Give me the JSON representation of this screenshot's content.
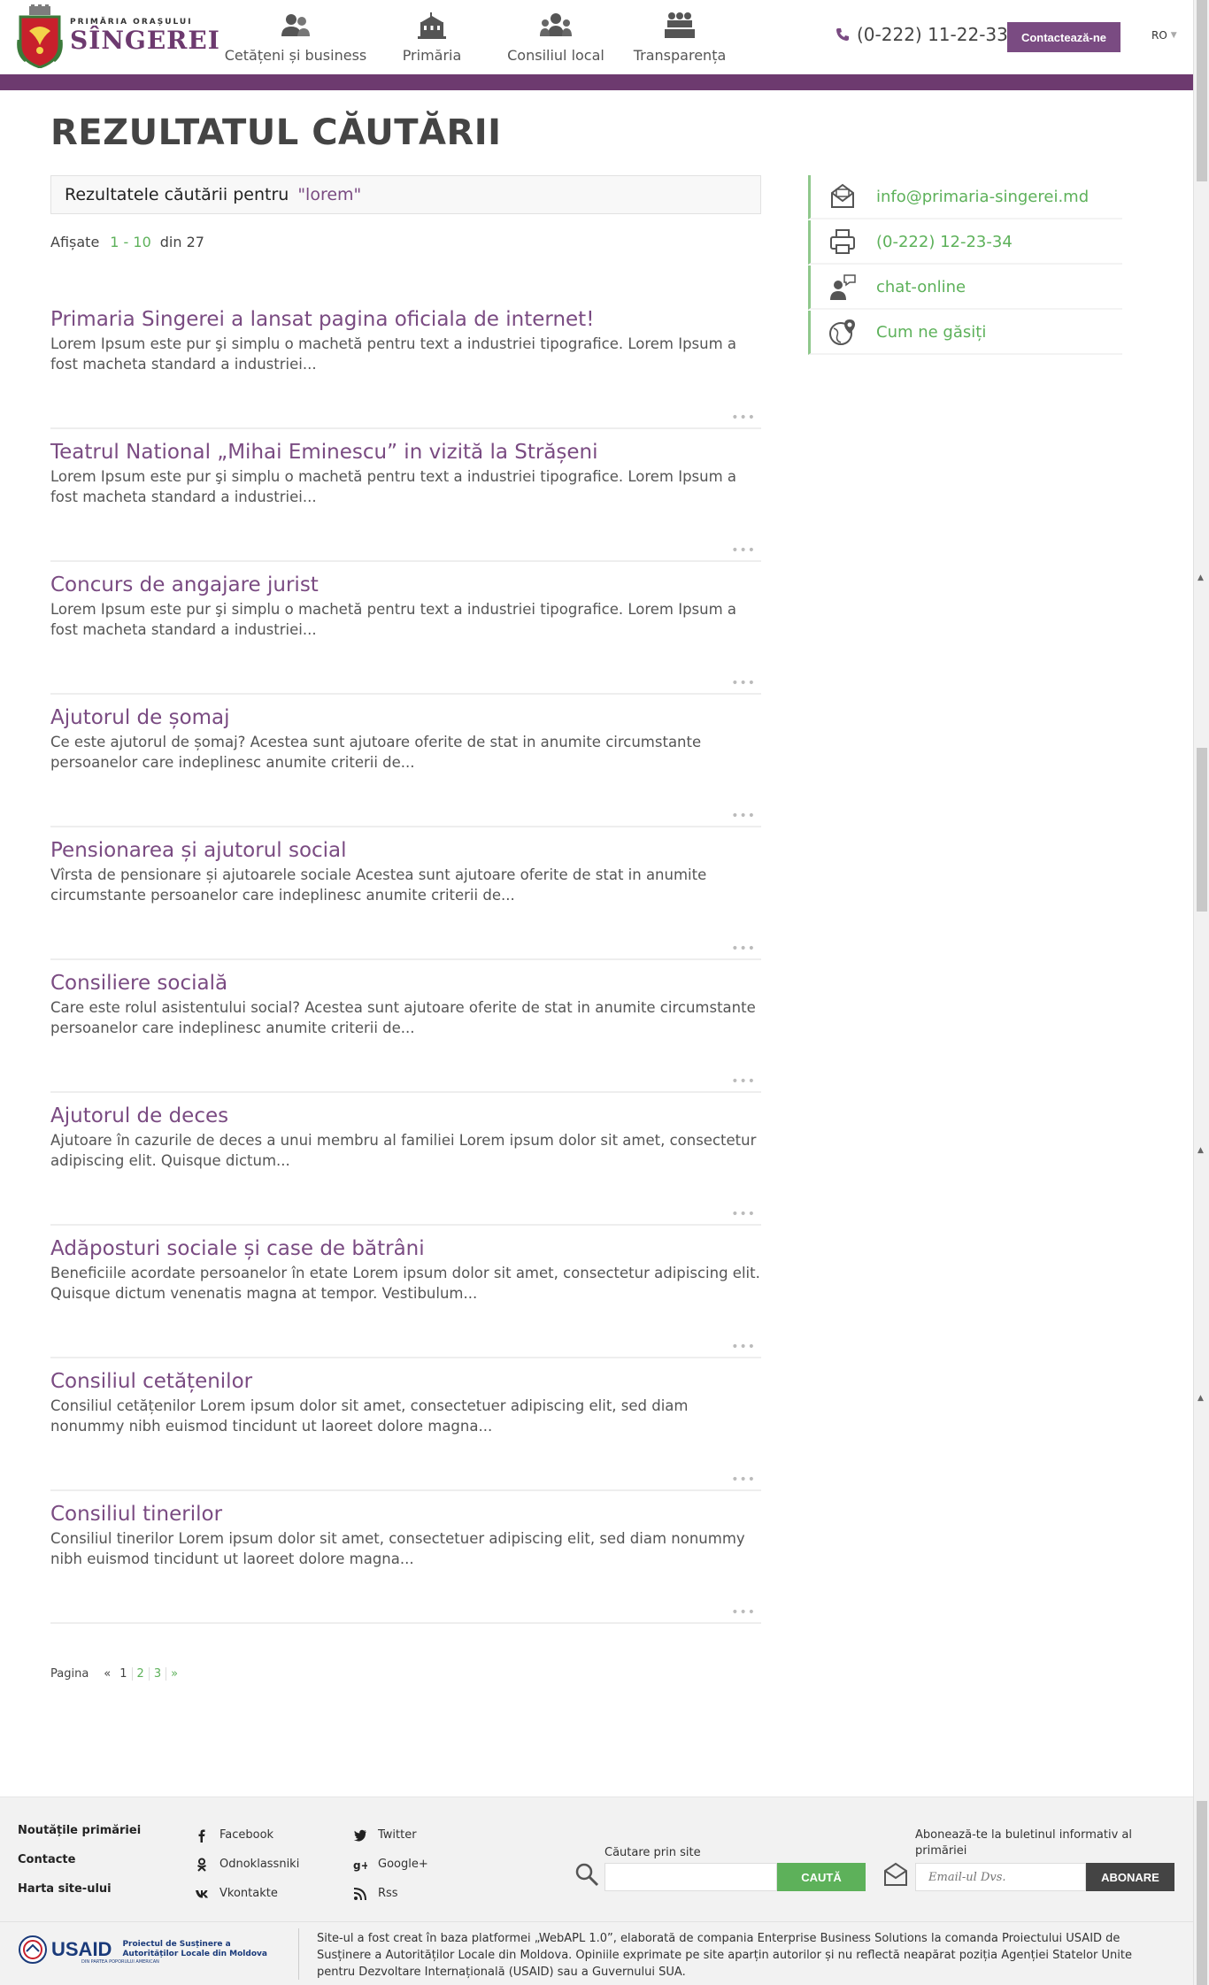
{
  "header": {
    "logo_small": "PRIMĂRIA ORAȘULUI",
    "logo_big": "SÎNGEREI",
    "nav": [
      {
        "label": "Cetățeni și business",
        "icon": "people-icon"
      },
      {
        "label": "Primăria",
        "icon": "city-hall-icon"
      },
      {
        "label": "Consiliul local",
        "icon": "council-icon"
      },
      {
        "label": "Transparența",
        "icon": "meeting-icon"
      }
    ],
    "phone": "(0-222) 11-22-33",
    "contact_label": "Contactează-ne",
    "language": "RO"
  },
  "colors": {
    "purple": "#6d3a6f",
    "accent_purple": "#7a4b82",
    "green": "#5db15a"
  },
  "main": {
    "title": "REZULTATUL CĂUTĂRII",
    "search_label": "Rezultatele căutării pentru",
    "search_query": "\"lorem\"",
    "shown_label": "Afișate",
    "shown_range": "1 - 10",
    "shown_total": "din 27",
    "results": [
      {
        "title": "Primaria Singerei a lansat pagina oficiala de internet!",
        "text": "Lorem Ipsum este pur şi simplu o machetă pentru text a industriei tipografice. Lorem Ipsum a fost macheta standard a industriei..."
      },
      {
        "title": "Teatrul National „Mihai Eminescu” in vizită la Strășeni",
        "text": "Lorem Ipsum este pur şi simplu o machetă pentru text a industriei tipografice. Lorem Ipsum a fost macheta standard a industriei..."
      },
      {
        "title": "Concurs de angajare jurist",
        "text": "Lorem Ipsum este pur şi simplu o machetă pentru text a industriei tipografice. Lorem Ipsum a fost macheta standard a industriei..."
      },
      {
        "title": "Ajutorul de șomaj",
        "text": "Ce este ajutorul de șomaj? Acestea sunt ajutoare oferite de stat in anumite circumstante persoanelor care indeplinesc anumite criterii de..."
      },
      {
        "title": "Pensionarea și ajutorul social",
        "text": "Vîrsta de pensionare și ajutoarele sociale Acestea sunt ajutoare oferite de stat in anumite circumstante persoanelor care indeplinesc anumite criterii de..."
      },
      {
        "title": "Consiliere socială",
        "text": "Care este rolul asistentului social? Acestea sunt ajutoare oferite de stat in anumite circumstante persoanelor care indeplinesc anumite criterii de..."
      },
      {
        "title": "Ajutorul de deces",
        "text": "Ajutoare în cazurile de deces a unui membru al familiei Lorem ipsum dolor sit amet, consectetur adipiscing elit. Quisque dictum..."
      },
      {
        "title": "Adăposturi sociale și case de bătrâni",
        "text": "Beneficiile acordate persoanelor în etate Lorem ipsum dolor sit amet, consectetur adipiscing elit. Quisque dictum venenatis magna at tempor. Vestibulum..."
      },
      {
        "title": "Consiliul cetățenilor",
        "text": "Consiliul cetățenilor Lorem ipsum dolor sit amet, consectetuer adipiscing elit, sed diam nonummy nibh euismod tincidunt ut laoreet dolore magna..."
      },
      {
        "title": "Consiliul tinerilor",
        "text": "Consiliul tinerilor Lorem ipsum dolor sit amet, consectetuer adipiscing elit, sed diam nonummy nibh euismod tincidunt ut laoreet dolore magna..."
      }
    ],
    "more_label": "•••",
    "pager": {
      "label": "Pagina",
      "prev": "«",
      "pages": [
        "1",
        "2",
        "3"
      ],
      "next": "»",
      "current": "1"
    }
  },
  "sidebar": [
    {
      "label": "info@primaria-singerei.md",
      "icon": "mail-icon"
    },
    {
      "label": "(0-222) 12-23-34",
      "icon": "fax-icon"
    },
    {
      "label": "chat-online",
      "icon": "chat-icon"
    },
    {
      "label": "Cum ne găsiți",
      "icon": "globe-location-icon"
    }
  ],
  "footer": {
    "links": [
      "Noutățile primăriei",
      "Contacte",
      "Harta site-ului"
    ],
    "social_col1": [
      {
        "label": "Facebook",
        "icon": "facebook-icon"
      },
      {
        "label": "Odnoklassniki",
        "icon": "odnoklassniki-icon"
      },
      {
        "label": "Vkontakte",
        "icon": "vkontakte-icon"
      }
    ],
    "social_col2": [
      {
        "label": "Twitter",
        "icon": "twitter-icon"
      },
      {
        "label": "Google+",
        "icon": "googleplus-icon"
      },
      {
        "label": "Rss",
        "icon": "rss-icon"
      }
    ],
    "search_label": "Căutare prin site",
    "search_button": "CAUTĂ",
    "newsletter_label": "Abonează-te la buletinul informativ al primăriei",
    "newsletter_placeholder": "Email-ul Dvs.",
    "newsletter_button": "ABONARE",
    "usaid": "USAID",
    "usaid_sub": "DIN PARTEA POPORULUI AMERICAN",
    "project": "Proiectul de Susținere a Autorităților Locale din Moldova",
    "note": "Site-ul a fost creat în baza platformei „WebAPL 1.0”, elaborată de compania Enterprise Business Solutions la comanda Proiectului USAID de Susținere a Autorităților Locale din Moldova. Opiniile exprimate pe site aparțin autorilor și nu reflectă neapărat poziția Agenției Statelor Unite pentru Dezvoltare Internațională (USAID) sau a Guvernului SUA."
  }
}
